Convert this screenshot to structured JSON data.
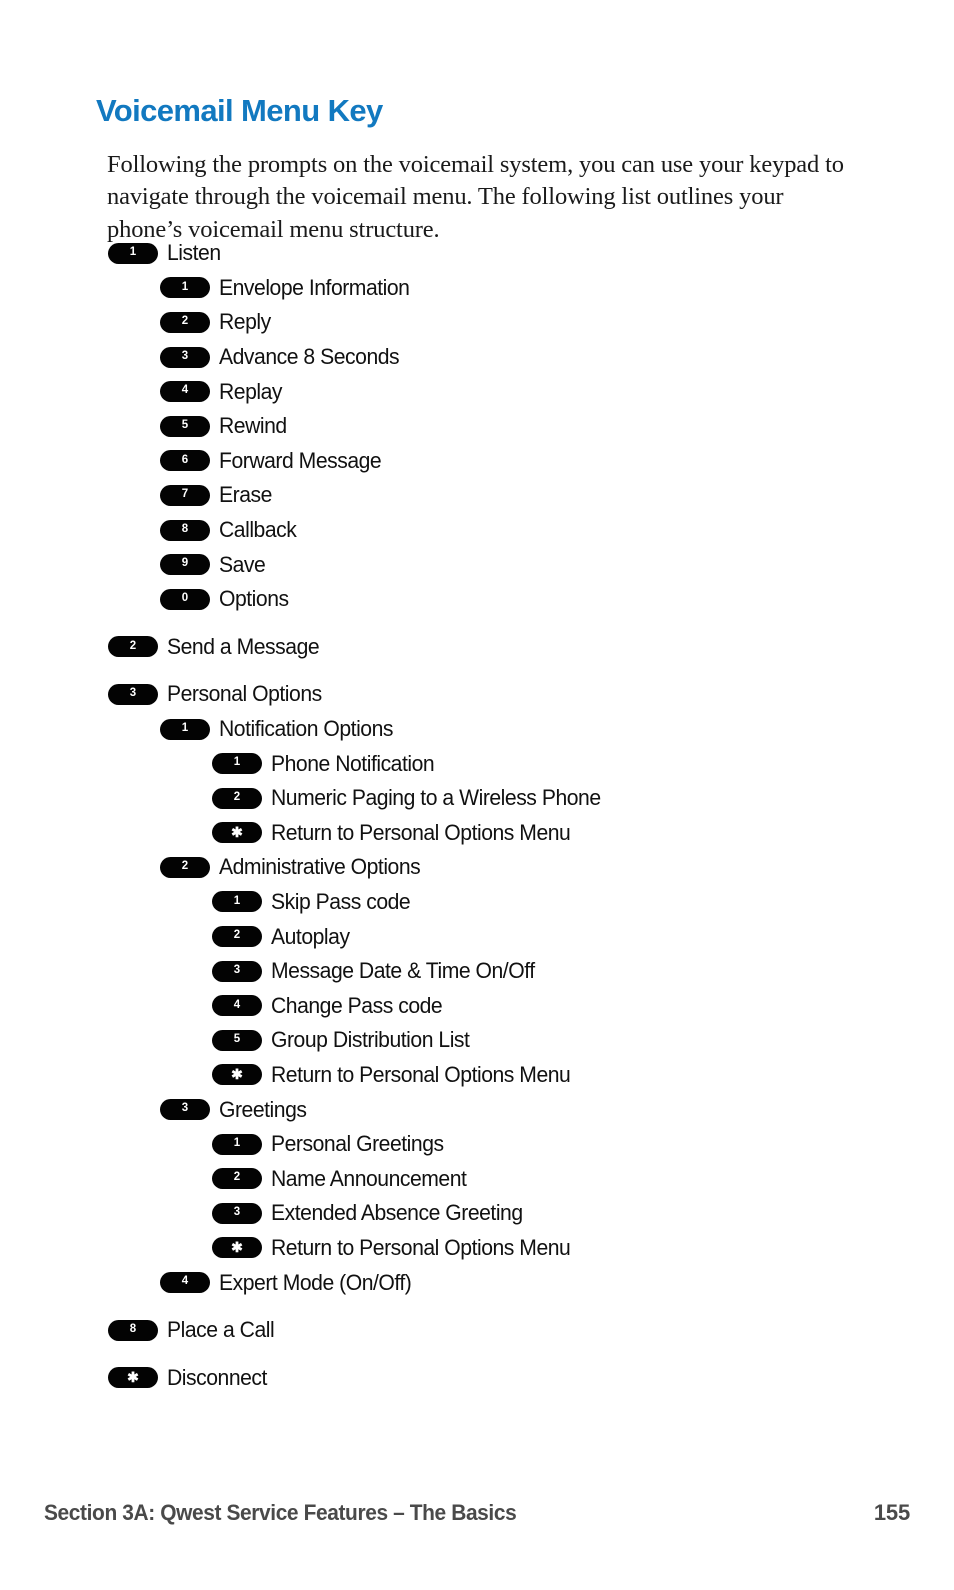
{
  "document": {
    "title": "Voicemail Menu Key",
    "title_color": "#1279c0",
    "intro": "Following the prompts on the voicemail system, you can use your keypad to navigate through the voicemail menu. The following list outlines your phone’s voicemail menu structure.",
    "badge_color": "#030303",
    "badge_text_color": "#ffffff"
  },
  "menu": [
    {
      "key": "1",
      "label": "Listen",
      "level": 1,
      "gap": false
    },
    {
      "key": "1",
      "label": "Envelope Information",
      "level": 2,
      "gap": false
    },
    {
      "key": "2",
      "label": "Reply",
      "level": 2,
      "gap": false
    },
    {
      "key": "3",
      "label": "Advance 8 Seconds",
      "level": 2,
      "gap": false
    },
    {
      "key": "4",
      "label": "Replay",
      "level": 2,
      "gap": false
    },
    {
      "key": "5",
      "label": "Rewind",
      "level": 2,
      "gap": false
    },
    {
      "key": "6",
      "label": "Forward Message",
      "level": 2,
      "gap": false
    },
    {
      "key": "7",
      "label": "Erase",
      "level": 2,
      "gap": false
    },
    {
      "key": "8",
      "label": "Callback",
      "level": 2,
      "gap": false
    },
    {
      "key": "9",
      "label": "Save",
      "level": 2,
      "gap": false
    },
    {
      "key": "0",
      "label": "Options",
      "level": 2,
      "gap": false
    },
    {
      "key": "2",
      "label": "Send a Message",
      "level": 1,
      "gap": true
    },
    {
      "key": "3",
      "label": "Personal Options",
      "level": 1,
      "gap": true
    },
    {
      "key": "1",
      "label": "Notification Options",
      "level": 2,
      "gap": false
    },
    {
      "key": "1",
      "label": "Phone Notification",
      "level": 3,
      "gap": false
    },
    {
      "key": "2",
      "label": "Numeric Paging to a Wireless Phone",
      "level": 3,
      "gap": false
    },
    {
      "key": "✱",
      "label": "Return to Personal Options Menu",
      "level": 3,
      "gap": false,
      "star": true
    },
    {
      "key": "2",
      "label": "Administrative Options",
      "level": 2,
      "gap": false
    },
    {
      "key": "1",
      "label": "Skip Pass code",
      "level": 3,
      "gap": false
    },
    {
      "key": "2",
      "label": "Autoplay",
      "level": 3,
      "gap": false
    },
    {
      "key": "3",
      "label": "Message Date & Time On/Off",
      "level": 3,
      "gap": false
    },
    {
      "key": "4",
      "label": "Change Pass code",
      "level": 3,
      "gap": false
    },
    {
      "key": "5",
      "label": "Group Distribution List",
      "level": 3,
      "gap": false
    },
    {
      "key": "✱",
      "label": "Return to Personal Options Menu",
      "level": 3,
      "gap": false,
      "star": true
    },
    {
      "key": "3",
      "label": "Greetings",
      "level": 2,
      "gap": false
    },
    {
      "key": "1",
      "label": "Personal Greetings",
      "level": 3,
      "gap": false
    },
    {
      "key": "2",
      "label": "Name Announcement",
      "level": 3,
      "gap": false
    },
    {
      "key": "3",
      "label": "Extended Absence Greeting",
      "level": 3,
      "gap": false
    },
    {
      "key": "✱",
      "label": "Return to Personal Options Menu",
      "level": 3,
      "gap": false,
      "star": true
    },
    {
      "key": "4",
      "label": "Expert Mode  (On/Off)",
      "level": 2,
      "gap": false
    },
    {
      "key": "8",
      "label": "Place a Call",
      "level": 1,
      "gap": true
    },
    {
      "key": "✱",
      "label": "Disconnect",
      "level": 1,
      "gap": true,
      "star": true
    }
  ],
  "footer": {
    "section": "Section 3A: Qwest Service Features – The Basics",
    "page_number": "155"
  }
}
